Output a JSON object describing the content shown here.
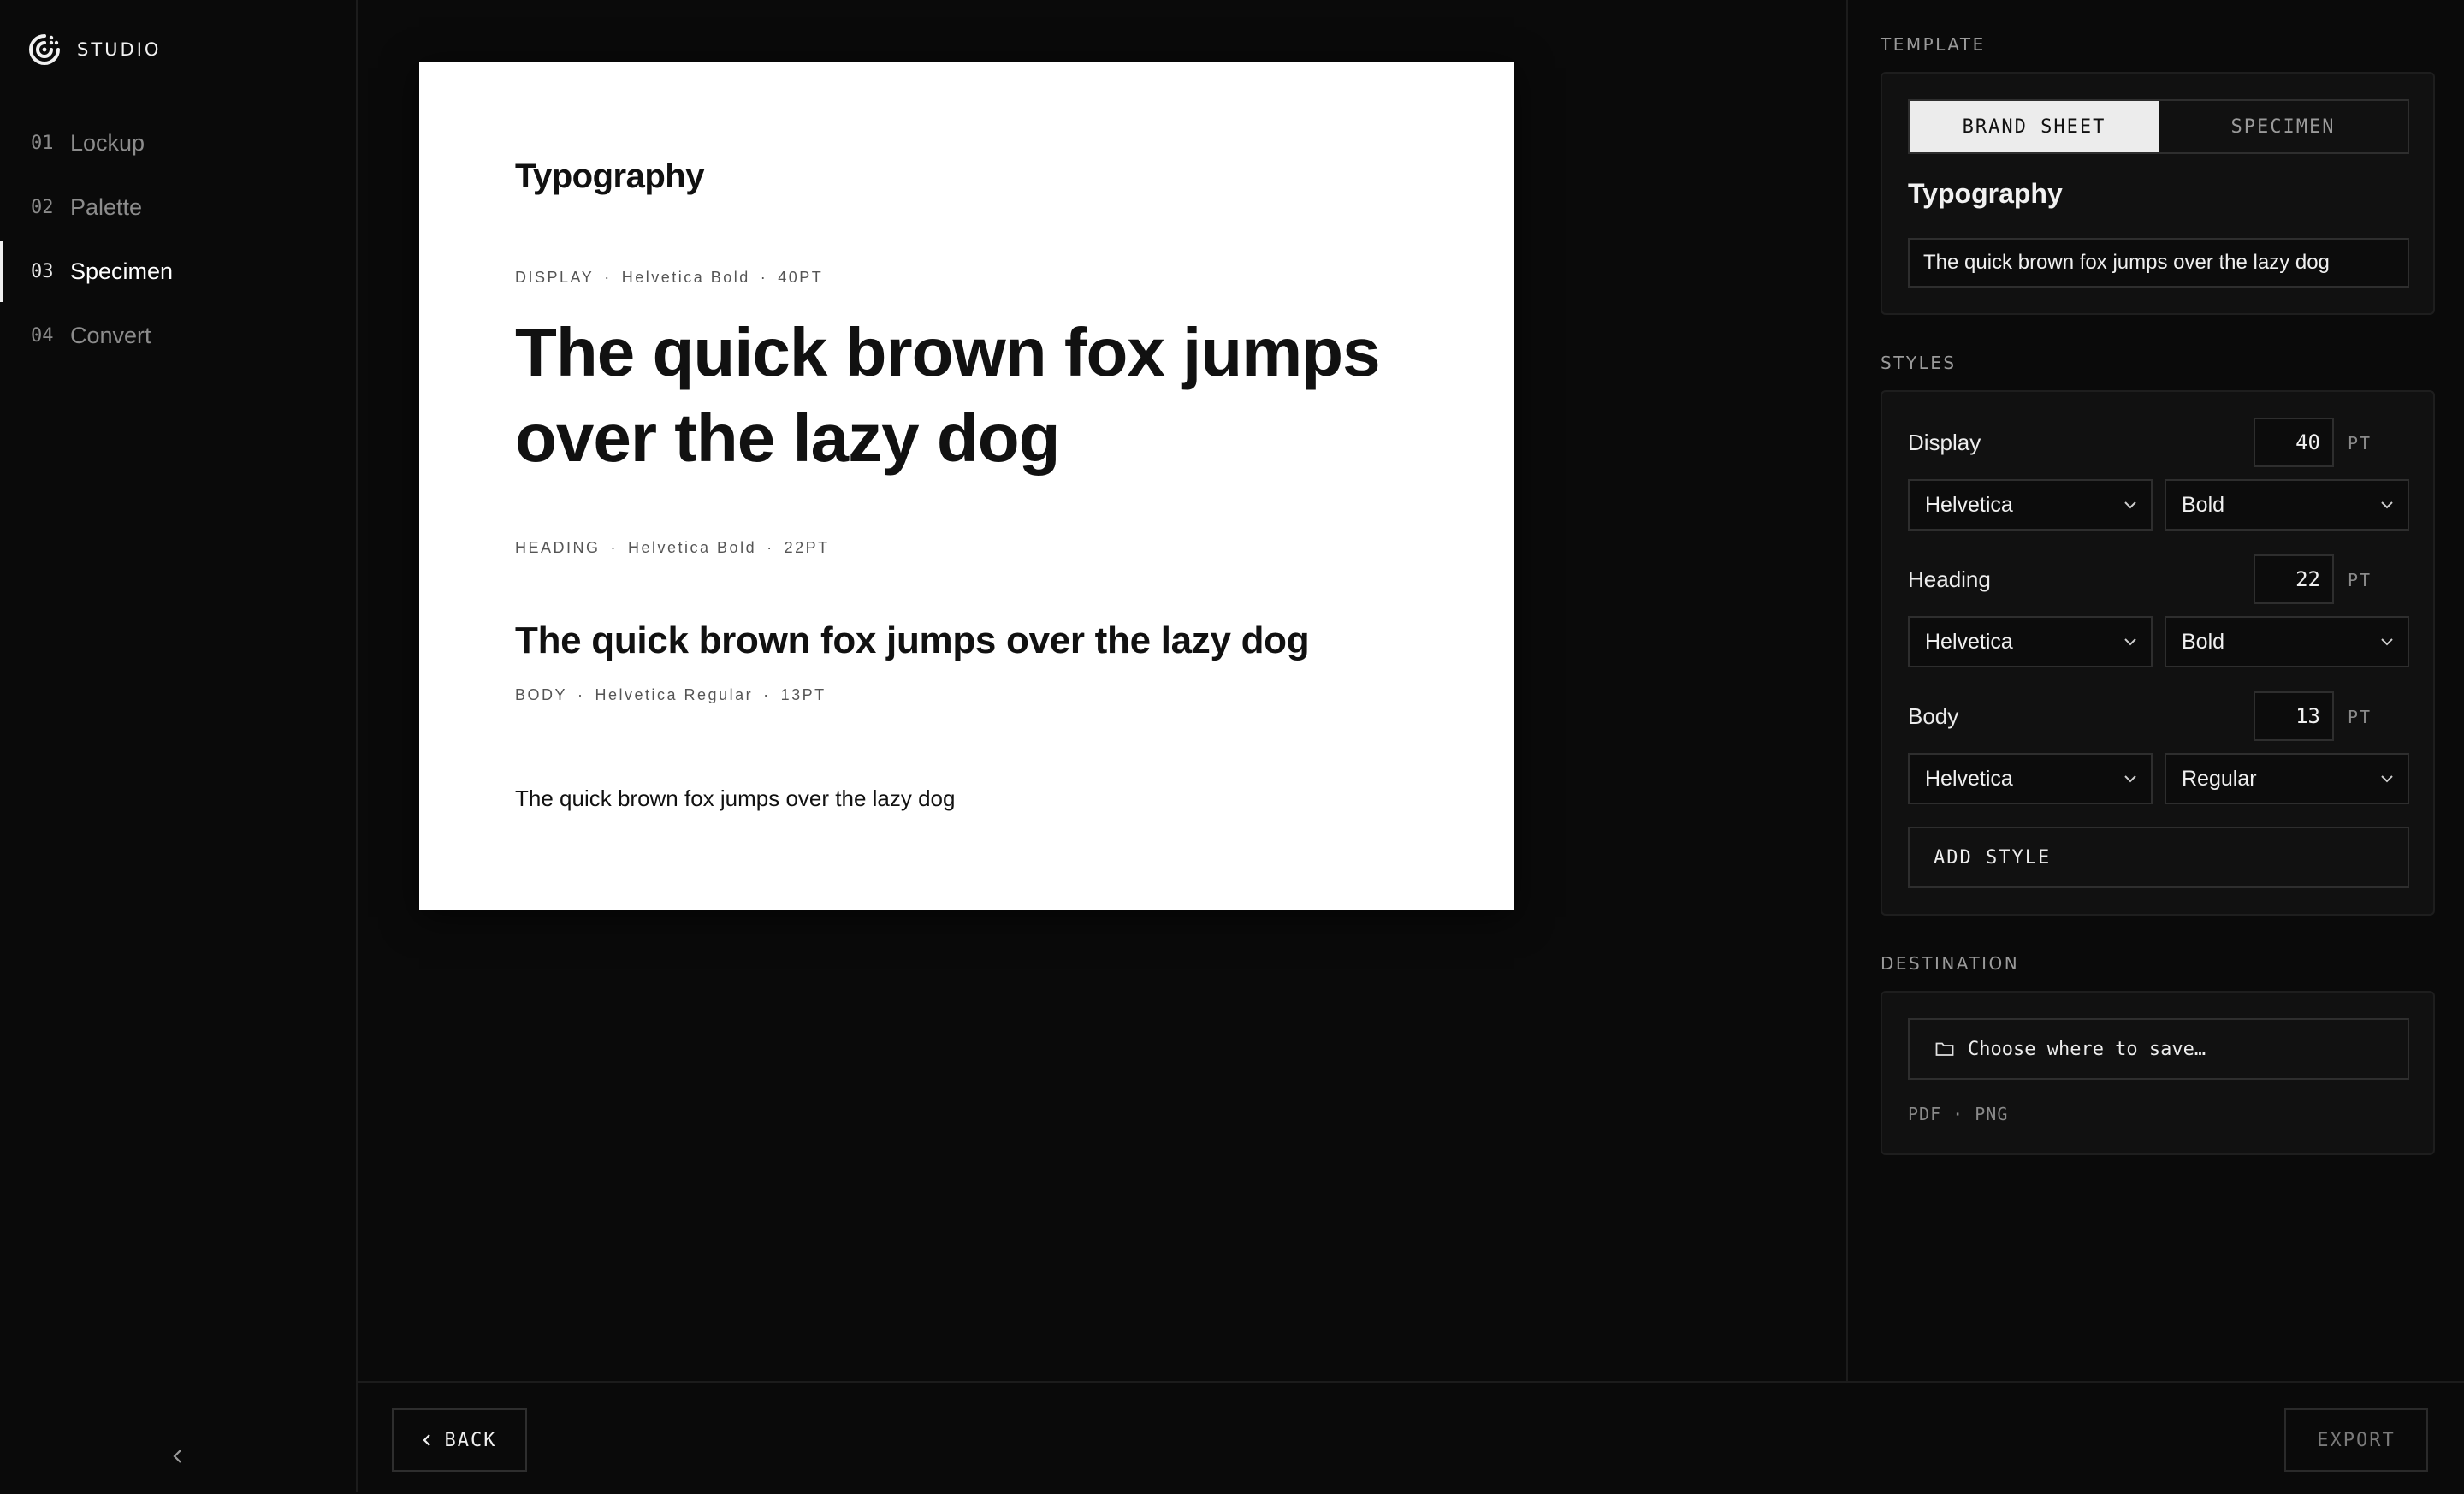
{
  "app": {
    "name": "STUDIO"
  },
  "nav": {
    "items": [
      {
        "num": "01",
        "label": "Lockup"
      },
      {
        "num": "02",
        "label": "Palette"
      },
      {
        "num": "03",
        "label": "Specimen"
      },
      {
        "num": "04",
        "label": "Convert"
      }
    ],
    "active_index": 2
  },
  "sheet": {
    "title": "Typography",
    "display": {
      "meta": [
        "DISPLAY",
        "Helvetica Bold",
        "40PT"
      ],
      "sample": "The quick brown fox jumps over the lazy dog"
    },
    "heading": {
      "meta": [
        "HEADING",
        "Helvetica Bold",
        "22PT"
      ],
      "sample": "The quick brown fox jumps over the lazy dog"
    },
    "body": {
      "meta": [
        "BODY",
        "Helvetica Regular",
        "13PT"
      ],
      "sample": "The quick brown fox jumps over the lazy dog"
    },
    "meta_separator": "·"
  },
  "panel": {
    "template": {
      "section_label": "TEMPLATE",
      "options": [
        "BRAND SHEET",
        "SPECIMEN"
      ],
      "selected": "BRAND SHEET",
      "title": "Typography",
      "sample_text": "The quick brown fox jumps over the lazy dog"
    },
    "styles": {
      "section_label": "STYLES",
      "unit": "PT",
      "items": [
        {
          "name": "Display",
          "size": "40",
          "family": "Helvetica",
          "weight": "Bold"
        },
        {
          "name": "Heading",
          "size": "22",
          "family": "Helvetica",
          "weight": "Bold"
        },
        {
          "name": "Body",
          "size": "13",
          "family": "Helvetica",
          "weight": "Regular"
        }
      ],
      "add_label": "ADD STYLE"
    },
    "destination": {
      "section_label": "DESTINATION",
      "button_label": "Choose where to save…",
      "formats": "PDF · PNG"
    }
  },
  "footer": {
    "back_label": "BACK",
    "export_label": "EXPORT"
  },
  "icons": {
    "logo": "studio-logo-icon",
    "collapse": "chevron-left-icon",
    "back": "chevron-left-icon",
    "select": "chevron-down-icon",
    "folder": "folder-icon"
  },
  "colors": {
    "background": "#0a0a0a",
    "panel_card": "#111111",
    "sheet": "#ffffff",
    "active": "#ececec"
  }
}
